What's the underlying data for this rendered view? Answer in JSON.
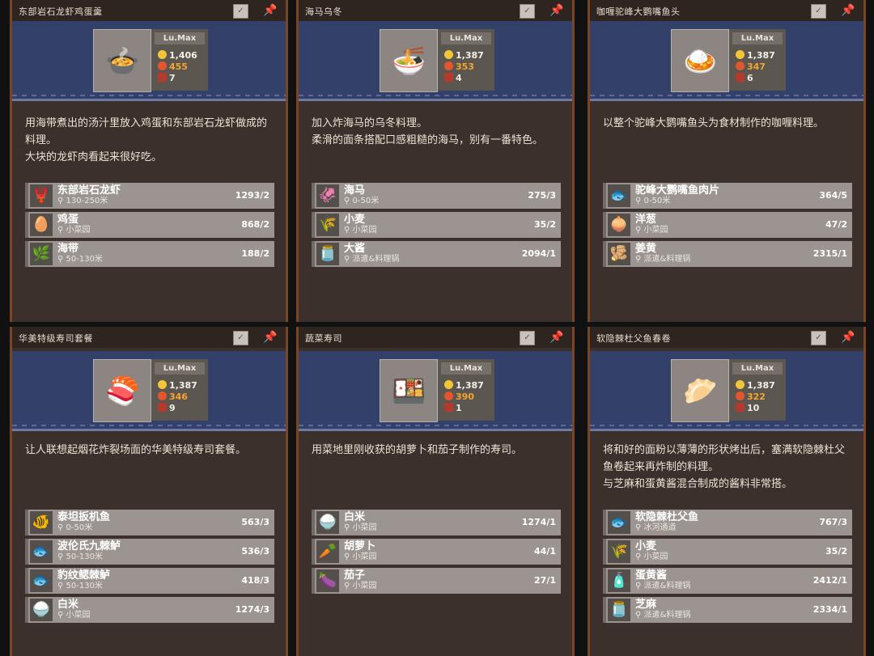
{
  "cards": [
    {
      "title": "东部岩石龙虾鸡蛋羹",
      "dish_icon": "🍲",
      "level": "Lu.Max",
      "price": "1,406",
      "energy": "455",
      "count": "7",
      "description": "用海带煮出的汤汁里放入鸡蛋和东部岩石龙虾做成的料理。\n大块的龙虾肉看起来很好吃。",
      "ingredients": [
        {
          "name": "东部岩石龙虾",
          "source": "130-250米",
          "amount": "1293/2",
          "icon": "🦞"
        },
        {
          "name": "鸡蛋",
          "source": "小菜园",
          "amount": "868/2",
          "icon": "🥚"
        },
        {
          "name": "海带",
          "source": "50-130米",
          "amount": "188/2",
          "icon": "🌿"
        }
      ]
    },
    {
      "title": "海马乌冬",
      "dish_icon": "🍜",
      "level": "Lu.Max",
      "price": "1,387",
      "energy": "353",
      "count": "4",
      "description": "加入炸海马的乌冬料理。\n柔滑的面条搭配口感粗糙的海马，别有一番特色。",
      "ingredients": [
        {
          "name": "海马",
          "source": "0-50米",
          "amount": "275/3",
          "icon": "🦑"
        },
        {
          "name": "小麦",
          "source": "小菜园",
          "amount": "35/2",
          "icon": "🌾"
        },
        {
          "name": "大酱",
          "source": "派遣&料理锅",
          "amount": "2094/1",
          "icon": "🫙"
        }
      ]
    },
    {
      "title": "咖喱驼峰大鹦嘴鱼头",
      "dish_icon": "🍛",
      "level": "Lu.Max",
      "price": "1,387",
      "energy": "347",
      "count": "6",
      "description": "以整个驼峰大鹦嘴鱼头为食材制作的咖喱料理。",
      "ingredients": [
        {
          "name": "驼峰大鹦嘴鱼肉片",
          "source": "0-50米",
          "amount": "364/5",
          "icon": "🐟"
        },
        {
          "name": "洋葱",
          "source": "小菜园",
          "amount": "47/2",
          "icon": "🧅"
        },
        {
          "name": "姜黄",
          "source": "派遣&料理锅",
          "amount": "2315/1",
          "icon": "🫚"
        }
      ]
    },
    {
      "title": "华美特级寿司套餐",
      "dish_icon": "🍣",
      "level": "Lu.Max",
      "price": "1,387",
      "energy": "346",
      "count": "9",
      "description": "让人联想起烟花炸裂场面的华美特级寿司套餐。",
      "ingredients": [
        {
          "name": "泰坦扳机鱼",
          "source": "0-50米",
          "amount": "563/3",
          "icon": "🐠"
        },
        {
          "name": "波伦氏九棘鲈",
          "source": "50-130米",
          "amount": "536/3",
          "icon": "🐟"
        },
        {
          "name": "豹纹鳃棘鲈",
          "source": "50-130米",
          "amount": "418/3",
          "icon": "🐟"
        },
        {
          "name": "白米",
          "source": "小菜园",
          "amount": "1274/3",
          "icon": "🍚"
        }
      ]
    },
    {
      "title": "蔬菜寿司",
      "dish_icon": "🍱",
      "level": "Lu.Max",
      "price": "1,387",
      "energy": "390",
      "count": "1",
      "description": "用菜地里刚收获的胡萝卜和茄子制作的寿司。",
      "ingredients": [
        {
          "name": "白米",
          "source": "小菜园",
          "amount": "1274/1",
          "icon": "🍚"
        },
        {
          "name": "胡萝卜",
          "source": "小菜园",
          "amount": "44/1",
          "icon": "🥕"
        },
        {
          "name": "茄子",
          "source": "小菜园",
          "amount": "27/1",
          "icon": "🍆"
        }
      ]
    },
    {
      "title": "软隐棘杜父鱼春卷",
      "dish_icon": "🥟",
      "level": "Lu.Max",
      "price": "1,387",
      "energy": "322",
      "count": "10",
      "description": "将和好的面粉以薄薄的形状烤出后，塞满软隐棘杜父鱼卷起来再炸制的料理。\n与芝麻和蛋黄酱混合制成的酱料非常搭。",
      "ingredients": [
        {
          "name": "软隐棘杜父鱼",
          "source": "冰河通道",
          "amount": "767/3",
          "icon": "🐟"
        },
        {
          "name": "小麦",
          "source": "小菜园",
          "amount": "35/2",
          "icon": "🌾"
        },
        {
          "name": "蛋黄酱",
          "source": "派遣&料理锅",
          "amount": "2412/1",
          "icon": "🧴"
        },
        {
          "name": "芝麻",
          "source": "派遣&料理锅",
          "amount": "2334/1",
          "icon": "🫙"
        }
      ]
    }
  ]
}
